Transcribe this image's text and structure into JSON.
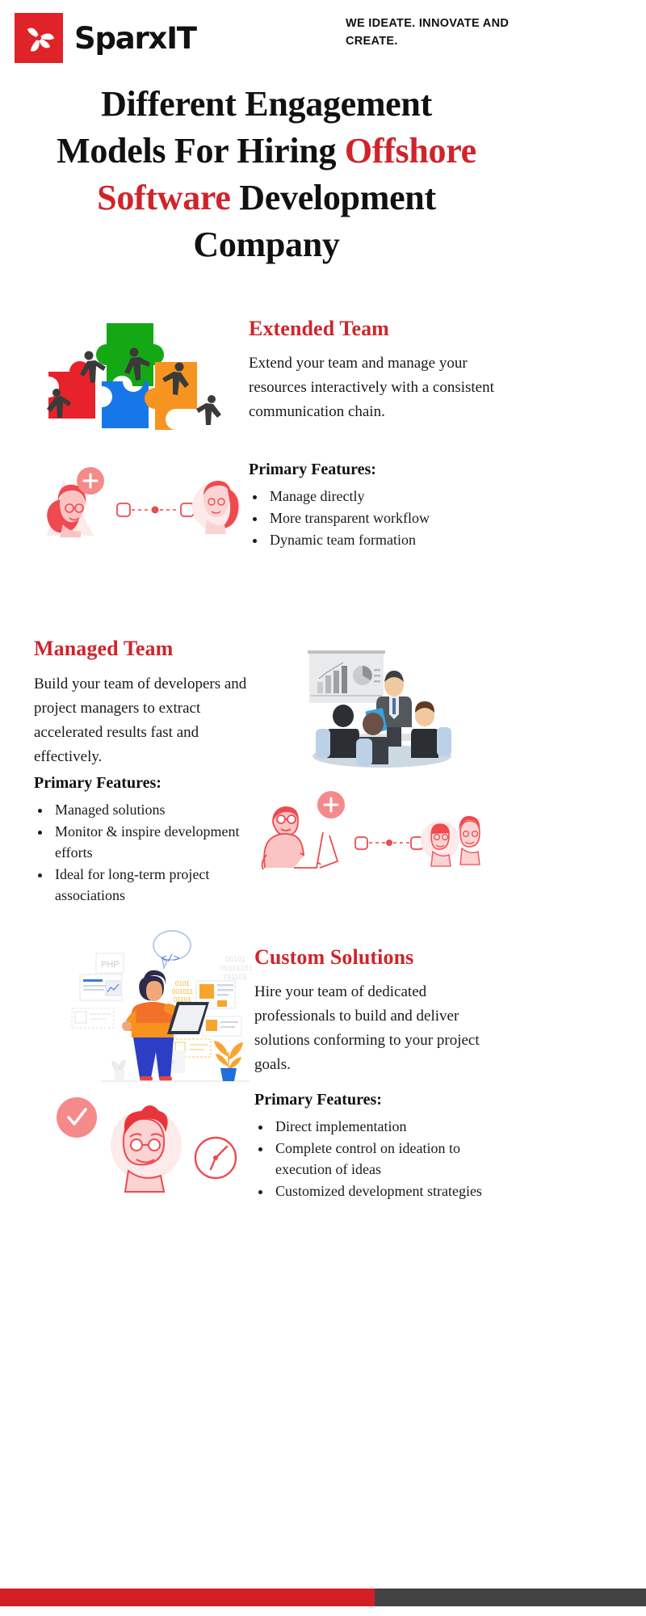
{
  "brand": {
    "name": "SparxIT",
    "logo_icon": "pinwheel-icon",
    "logo_bg": "#e02329",
    "tagline": "WE IDEATE. INNOVATE AND CREATE."
  },
  "title": {
    "part1": "Different Engagement Models For Hiring ",
    "highlight": "Offshore Software",
    "part2": " Development Company",
    "full": "Different Engagement Models For Hiring Offshore Software Development Company",
    "line1": "Different Engagement",
    "line2_a": "Models For Hiring ",
    "line2_b": "Offshore",
    "line3_a": "Software",
    "line3_b": " Development",
    "line4": "Company",
    "accent_color": "#d0242b"
  },
  "features_label": "Primary Features:",
  "sections": [
    {
      "id": "extended-team",
      "heading": "Extended Team",
      "description": "Extend your team and manage your resources interactively with a consistent communication chain.",
      "features_label": "Primary Features:",
      "features": [
        "Manage directly",
        "More transparent workflow",
        "Dynamic team formation"
      ],
      "illustration": "puzzle-teamwork-illustration",
      "illustration_alt": "connection-people-illustration"
    },
    {
      "id": "managed-team",
      "heading": "Managed Team",
      "description": "Build your team of developers and project managers to extract accelerated results fast and effectively.",
      "features_label": "Primary Features:",
      "features": [
        "Managed solutions",
        "Monitor & inspire development efforts",
        "Ideal for long-term project associations"
      ],
      "illustration": "business-meeting-illustration",
      "illustration_alt": "laptop-connection-illustration"
    },
    {
      "id": "custom-solutions",
      "heading": "Custom Solutions",
      "description": "Hire your team of dedicated professionals to build and deliver solutions conforming to your project goals.",
      "features_label": "Primary Features:",
      "features": [
        "Direct implementation",
        "Complete control on ideation to execution of ideas",
        "Customized development strategies"
      ],
      "illustration": "developer-tablet-illustration",
      "illustration_alt": "checkmark-clock-person-illustration"
    }
  ],
  "illustration_labels": {
    "php_card": "PHP",
    "code_bubble": "</>",
    "binary_1": "00101",
    "binary_2": "00101101",
    "binary_3": "011101",
    "binary_4": "0101",
    "binary_5": "001011",
    "binary_6": "01101"
  },
  "footer": {
    "red_color": "#d32027",
    "dark_color": "#434343",
    "red_width_pct": 58
  }
}
